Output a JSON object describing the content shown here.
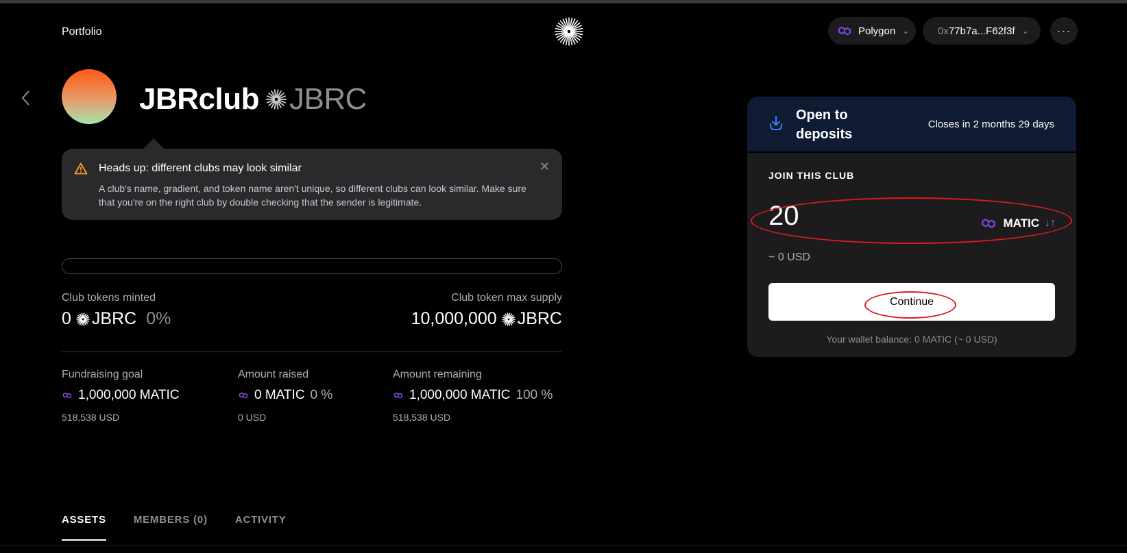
{
  "header": {
    "portfolio_label": "Portfolio",
    "network": "Polygon",
    "wallet_prefix": "0x",
    "wallet_rest": "77b7a...F62f3f",
    "more_label": "···"
  },
  "club": {
    "name": "JBRclub",
    "symbol": "JBRC"
  },
  "notice": {
    "title": "Heads up: different clubs may look similar",
    "body": "A club's name, gradient, and token name aren't unique, so different clubs can look similar. Make sure that you're on the right club by double checking that the sender is legitimate."
  },
  "progress": {
    "fraction": 0
  },
  "tokens": {
    "minted_label": "Club tokens minted",
    "minted_value": "0",
    "minted_symbol": "JBRC",
    "minted_percent": "0%",
    "max_label": "Club token max supply",
    "max_value": "10,000,000",
    "max_symbol": "JBRC"
  },
  "stats": [
    {
      "label": "Fundraising goal",
      "value": "1,000,000 MATIC",
      "percent": "",
      "usd": "518,538 USD"
    },
    {
      "label": "Amount raised",
      "value": "0 MATIC",
      "percent": "0 %",
      "usd": "0 USD"
    },
    {
      "label": "Amount remaining",
      "value": "1,000,000 MATIC",
      "percent": "100 %",
      "usd": "518,538 USD"
    }
  ],
  "tabs": [
    {
      "label": "ASSETS",
      "active": true
    },
    {
      "label": "MEMBERS (0)",
      "active": false
    },
    {
      "label": "ACTIVITY",
      "active": false
    }
  ],
  "deposit": {
    "status": "Open to deposits",
    "closes": "Closes in 2 months 29 days",
    "join_label": "JOIN THIS CLUB",
    "amount": "20",
    "token": "MATIC",
    "swap_icon": "↓↑",
    "usd_estimate": "~ 0 USD",
    "continue_label": "Continue",
    "balance": "Your wallet balance: 0 MATIC (~ 0 USD)"
  },
  "colors": {
    "polygon": "#8247e5",
    "accent_blue": "#3b82f6",
    "warning": "#f5a623",
    "annotation": "#e0191d"
  }
}
